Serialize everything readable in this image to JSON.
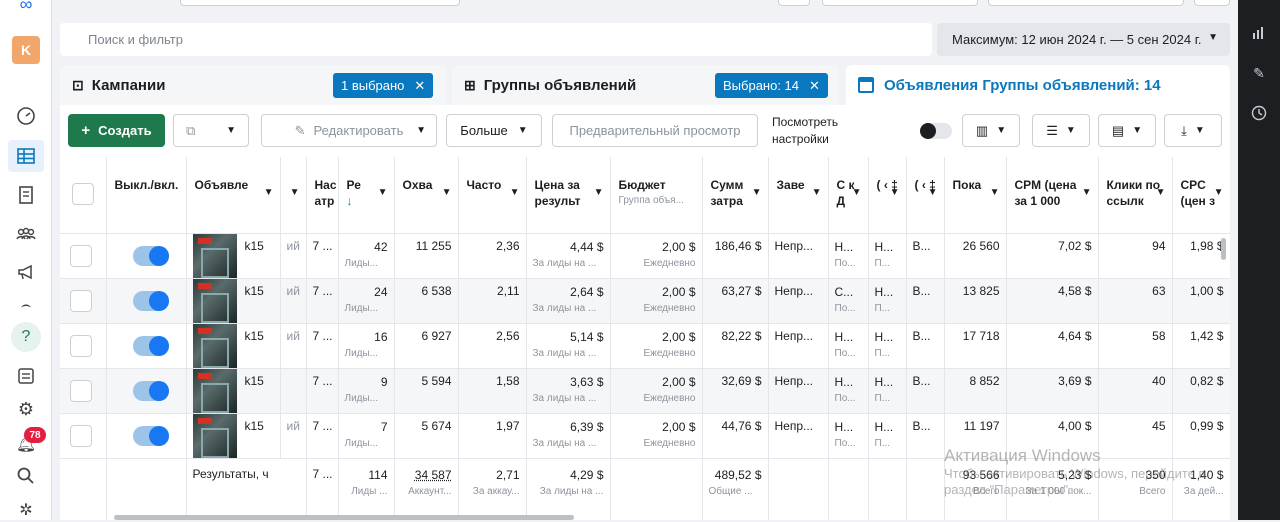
{
  "left_nav": {
    "avatar_letter": "K",
    "notification_count": "78",
    "help_label": "?"
  },
  "search": {
    "placeholder": "Поиск и фильтр"
  },
  "date_range": "Максимум: 12 июн 2024 г. — 5 сен 2024 г.",
  "tabs": {
    "campaigns": {
      "label": "Кампании",
      "pill": "1 выбрано"
    },
    "adsets": {
      "label": "Группы объявлений",
      "pill": "Выбрано: 14"
    },
    "ads": {
      "label": "Объявления Группы объявлений: 14"
    }
  },
  "toolbar": {
    "create": "Создать",
    "edit": "Редактировать",
    "more": "Больше",
    "preview": "Предварительный просмотр",
    "view_settings": "Посмотреть настройки"
  },
  "columns": {
    "toggle": "Выкл./вкл.",
    "ad": "Объявле",
    "setting": "Нас атр",
    "results": "Ре",
    "reach": "Охва",
    "frequency": "Часто",
    "cost_per_result": "Цена за результ",
    "budget": "Бюджет",
    "budget_sub": "Группа объя...",
    "spent": "Сумм затра",
    "end": "Заве",
    "c1": "С к Д",
    "c2": "( ‹ ‡",
    "c3": "( ‹ ‡",
    "c4": "( ‹ ‡",
    "impressions": "Пока",
    "cpm": "CPM (цена за 1 000",
    "clicks": "Клики по ссылк",
    "cpc": "CPC (цен з"
  },
  "rows": [
    {
      "name": "k15",
      "sub": "ий",
      "setting": "7 ...",
      "results": "42",
      "results_sub": "Лиды...",
      "reach": "11 255",
      "freq": "2,36",
      "cpr": "4,44 $",
      "cpr_sub": "За лиды на ...",
      "budget": "2,00 $",
      "budget_sub": "Ежедневно",
      "spent": "186,46 $",
      "end": "Непр...",
      "c1": "Н...",
      "c1s": "По...",
      "c2": "Н...",
      "c2s": "П...",
      "c3": "В...",
      "impr": "26 560",
      "cpm": "7,02 $",
      "clicks": "94",
      "cpc": "1,98 $"
    },
    {
      "name": "k15",
      "sub": "ий",
      "setting": "7 ...",
      "results": "24",
      "results_sub": "Лиды...",
      "reach": "6 538",
      "freq": "2,11",
      "cpr": "2,64 $",
      "cpr_sub": "За лиды на ...",
      "budget": "2,00 $",
      "budget_sub": "Ежедневно",
      "spent": "63,27 $",
      "end": "Непр...",
      "c1": "С...",
      "c1s": "По...",
      "c2": "Н...",
      "c2s": "П...",
      "c3": "В...",
      "impr": "13 825",
      "cpm": "4,58 $",
      "clicks": "63",
      "cpc": "1,00 $"
    },
    {
      "name": "k15",
      "sub": "ий",
      "setting": "7 ...",
      "results": "16",
      "results_sub": "Лиды...",
      "reach": "6 927",
      "freq": "2,56",
      "cpr": "5,14 $",
      "cpr_sub": "За лиды на ...",
      "budget": "2,00 $",
      "budget_sub": "Ежедневно",
      "spent": "82,22 $",
      "end": "Непр...",
      "c1": "Н...",
      "c1s": "По...",
      "c2": "Н...",
      "c2s": "П...",
      "c3": "В...",
      "impr": "17 718",
      "cpm": "4,64 $",
      "clicks": "58",
      "cpc": "1,42 $"
    },
    {
      "name": "k15",
      "sub": "",
      "setting": "7 ...",
      "results": "9",
      "results_sub": "Лиды...",
      "reach": "5 594",
      "freq": "1,58",
      "cpr": "3,63 $",
      "cpr_sub": "За лиды на ...",
      "budget": "2,00 $",
      "budget_sub": "Ежедневно",
      "spent": "32,69 $",
      "end": "Непр...",
      "c1": "Н...",
      "c1s": "По...",
      "c2": "Н...",
      "c2s": "П...",
      "c3": "В...",
      "impr": "8 852",
      "cpm": "3,69 $",
      "clicks": "40",
      "cpc": "0,82 $"
    },
    {
      "name": "k15",
      "sub": "ий",
      "setting": "7 ...",
      "results": "7",
      "results_sub": "Лиды...",
      "reach": "5 674",
      "freq": "1,97",
      "cpr": "6,39 $",
      "cpr_sub": "За лиды на ...",
      "budget": "2,00 $",
      "budget_sub": "Ежедневно",
      "spent": "44,76 $",
      "end": "Непр...",
      "c1": "Н...",
      "c1s": "По...",
      "c2": "Н...",
      "c2s": "П...",
      "c3": "В...",
      "impr": "11 197",
      "cpm": "4,00 $",
      "clicks": "45",
      "cpc": "0,99 $"
    }
  ],
  "totals": {
    "label": "Результаты, ч",
    "setting": "7 ...",
    "results": "114",
    "results_sub": "Лиды ...",
    "reach": "34 587",
    "reach_sub": "Аккаунт...",
    "freq": "2,71",
    "freq_sub": "За аккау...",
    "cpr": "4,29 $",
    "cpr_sub": "За лиды на ...",
    "spent": "489,52 $",
    "spent_sub": "Общие ...",
    "impr": "93 566",
    "impr_sub": "Всего",
    "cpm": "5,23 $",
    "cpm_sub": "За 1 000 пок...",
    "clicks": "350",
    "clicks_sub": "Всего",
    "cpc": "1,40 $",
    "cpc_sub": "За дей..."
  },
  "watermark": {
    "title": "Активация Windows",
    "line1": "Чтобы активировать Windows, перейдите в",
    "line2": "раздел \"Параметры\"."
  }
}
